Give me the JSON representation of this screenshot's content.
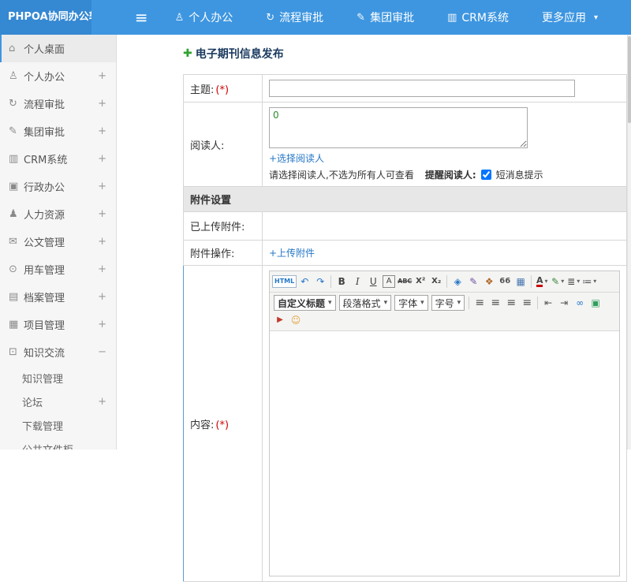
{
  "header": {
    "app_title": "PHPOA协同办公软件",
    "nav": [
      {
        "label": "个人办公"
      },
      {
        "label": "流程审批"
      },
      {
        "label": "集团审批"
      },
      {
        "label": "CRM系统"
      },
      {
        "label": "更多应用"
      }
    ]
  },
  "sidebar": {
    "items": [
      {
        "label": "个人桌面",
        "expand": ""
      },
      {
        "label": "个人办公",
        "expand": "+"
      },
      {
        "label": "流程审批",
        "expand": "+"
      },
      {
        "label": "集团审批",
        "expand": "+"
      },
      {
        "label": "CRM系统",
        "expand": "+"
      },
      {
        "label": "行政办公",
        "expand": "+"
      },
      {
        "label": "人力资源",
        "expand": "+"
      },
      {
        "label": "公文管理",
        "expand": "+"
      },
      {
        "label": "用车管理",
        "expand": "+"
      },
      {
        "label": "档案管理",
        "expand": "+"
      },
      {
        "label": "项目管理",
        "expand": "+"
      },
      {
        "label": "知识交流",
        "expand": "−"
      }
    ],
    "subitems": [
      {
        "label": "知识管理",
        "expand": ""
      },
      {
        "label": "论坛",
        "expand": "+"
      },
      {
        "label": "下载管理",
        "expand": ""
      },
      {
        "label": "公共文件柜",
        "expand": ""
      }
    ]
  },
  "main": {
    "page_title": "电子期刊信息发布",
    "form": {
      "subject_label": "主题:",
      "required": "(*)",
      "readers_label": "阅读人:",
      "readers_value": "0",
      "select_readers": "+选择阅读人",
      "readers_hint": "请选择阅读人,不选为所有人可查看",
      "remind_label": "提醒阅读人:",
      "sms_label": "短消息提示",
      "attach_section": "附件设置",
      "uploaded_label": "已上传附件:",
      "attach_op_label": "附件操作:",
      "upload_link": "+上传附件",
      "content_label": "内容:"
    },
    "editor": {
      "dropdowns": [
        {
          "label": "自定义标题"
        },
        {
          "label": "段落格式"
        },
        {
          "label": "字体"
        },
        {
          "label": "字号"
        }
      ]
    }
  },
  "icons": {
    "hamburger": "≡",
    "caret_down": "▾",
    "nav_person": "♙",
    "nav_flow": "↻",
    "nav_edit": "✎",
    "nav_chart": "▥",
    "home": "⌂",
    "person": "♙",
    "flow": "↻",
    "edit": "✎",
    "chart": "▥",
    "admin": "▣",
    "hr": "♟",
    "doc": "✉",
    "car": "⊙",
    "archive": "▤",
    "project": "▦",
    "knowledge": "⊡",
    "plus_green": "✚",
    "html": "HTML",
    "undo": "↶",
    "redo": "↷",
    "bold": "B",
    "italic": "I",
    "underline": "U",
    "font_box": "A",
    "strike": "ABC",
    "sup": "X²",
    "sub": "X₂",
    "eraser": "◈",
    "brush": "✎",
    "clear": "❖",
    "quote": "66",
    "table": "▦",
    "font_color": "A",
    "pen": "✎",
    "list_ul": "≣",
    "list_ol": "≔",
    "align_left": "≡",
    "align_center": "≡",
    "align_right": "≡",
    "align_justify": "≡",
    "outdent": "⇤",
    "indent": "⇥",
    "link": "∞",
    "image": "▣",
    "media": "▶",
    "emoji": "☺"
  }
}
